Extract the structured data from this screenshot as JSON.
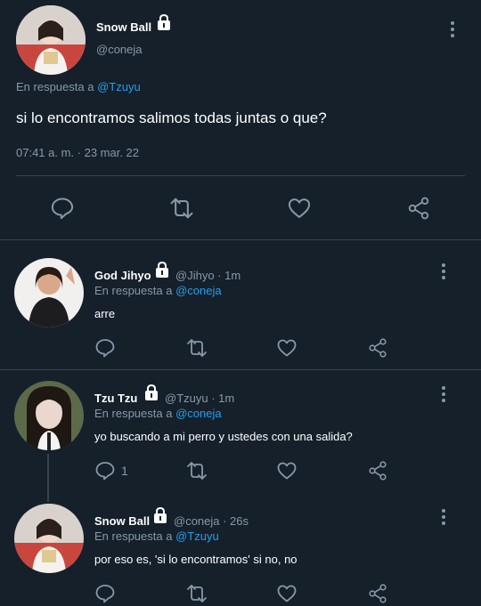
{
  "main_tweet": {
    "name": "Snow Ball",
    "handle": "@coneja",
    "reply_prefix": "En respuesta a",
    "reply_to": "@Tzuyu",
    "text": "si lo encontramos salimos todas juntas o que?",
    "timestamp": "07:41 a. m. · 23 mar. 22"
  },
  "replies": [
    {
      "name": "God Jihyo",
      "meta": "@Jihyo · 1m",
      "reply_prefix": "En respuesta a",
      "reply_to": "@coneja",
      "text": "arre",
      "reply_count": ""
    },
    {
      "name": "Tzu Tzu",
      "meta": "@Tzuyu · 1m",
      "reply_prefix": "En respuesta a",
      "reply_to": "@coneja",
      "text": "yo buscando a mi perro y ustedes con una salida?",
      "reply_count": "1"
    },
    {
      "name": "Snow Ball",
      "meta": "@coneja · 26s",
      "reply_prefix": "En respuesta a",
      "reply_to": "@Tzuyu",
      "text": "por eso es, 'si lo encontramos' si no, no",
      "reply_count": ""
    }
  ],
  "colors": {
    "background": "#15202b",
    "muted": "#8899a6",
    "accent": "#1da1f2",
    "divider": "#38444d"
  },
  "icons": [
    "lock-icon",
    "more-icon",
    "reply-icon",
    "retweet-icon",
    "like-icon",
    "share-icon"
  ]
}
